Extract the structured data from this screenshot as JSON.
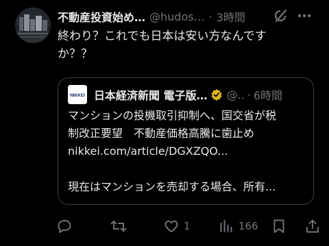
{
  "tweet": {
    "display_name": "不動産投資始め…",
    "handle": "@hudos…",
    "separator": "·",
    "time": "3時間",
    "text_line1": "終わり？これでも日本は安い方なんです",
    "text_line2": "か？？",
    "avatar_icon": "city-night-avatar",
    "grok_icon": "grok-slash-icon",
    "more_icon": "more-dots-icon"
  },
  "quote": {
    "display_name": "日本経済新聞 電子版…",
    "handle": "@..",
    "separator": "·",
    "time": "6時間",
    "avatar_text": "NIKKEI",
    "verified_color": "#e2b719",
    "lines": [
      "マンションの投機取引抑制へ、国交省が税",
      "制改正要望　不動産価格高騰に歯止め",
      "nikkei.com/article/DGXZQO...",
      "",
      "現在はマンションを売却する場合、所有..."
    ]
  },
  "actions": {
    "reply_count": "",
    "retweet_count": "",
    "like_count": "1",
    "views_count": "166"
  },
  "colors": {
    "background": "#000000",
    "text": "#e7e9ea",
    "muted": "#71767b",
    "border": "#3e4144"
  }
}
